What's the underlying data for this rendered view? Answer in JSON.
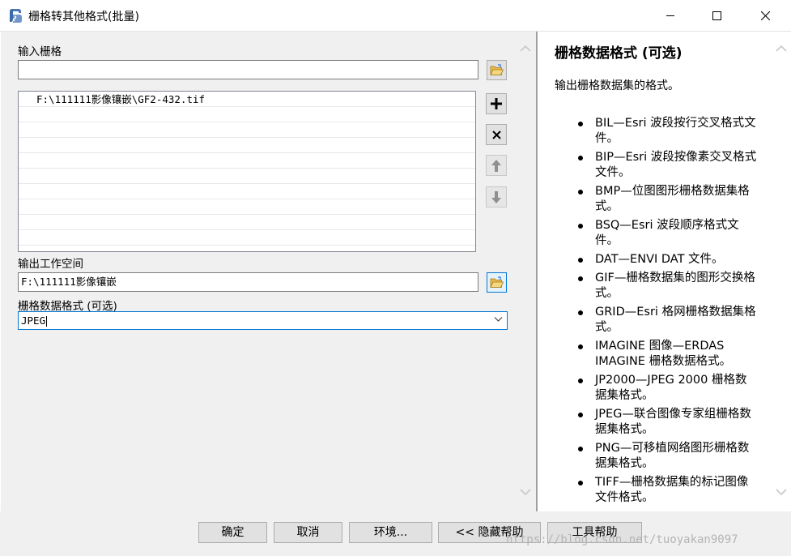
{
  "window": {
    "title": "栅格转其他格式(批量)",
    "icon": "python-script-icon"
  },
  "input_raster": {
    "label": "输入栅格",
    "value": "",
    "items": [
      "F:\\111111影像镶嵌\\GF2-432.tif",
      "",
      "",
      "",
      "",
      "",
      "",
      "",
      "",
      ""
    ]
  },
  "output_workspace": {
    "label": "输出工作空间",
    "value": "F:\\111111影像镶嵌"
  },
  "raster_format": {
    "label": "栅格数据格式 (可选)",
    "value": "JPEG"
  },
  "help": {
    "title": "栅格数据格式 (可选)",
    "description": "输出栅格数据集的格式。",
    "formats": [
      "BIL—Esri 波段按行交叉格式文件。",
      "BIP—Esri 波段按像素交叉格式文件。",
      "BMP—位图图形栅格数据集格式。",
      "BSQ—Esri 波段顺序格式文件。",
      "DAT—ENVI DAT 文件。",
      "GIF—栅格数据集的图形交换格式。",
      "GRID—Esri 格网栅格数据集格式。",
      "IMAGINE 图像—ERDAS IMAGINE 栅格数据格式。",
      "JP2000—JPEG 2000 栅格数据集格式。",
      "JPEG—联合图像专家组栅格数据集格式。",
      "PNG—可移植网络图形栅格数据集格式。",
      "TIFF—栅格数据集的标记图像文件格式。"
    ]
  },
  "buttons": {
    "ok": "确定",
    "cancel": "取消",
    "environments": "环境...",
    "hide_help": "<< 隐藏帮助",
    "tool_help": "工具帮助"
  },
  "watermark": "https://blog.csdn.net/tuoyakan9097",
  "colors": {
    "focus_border": "#0078d7",
    "panel_bg": "#f0f0f0",
    "button_bg": "#e1e1e1"
  }
}
